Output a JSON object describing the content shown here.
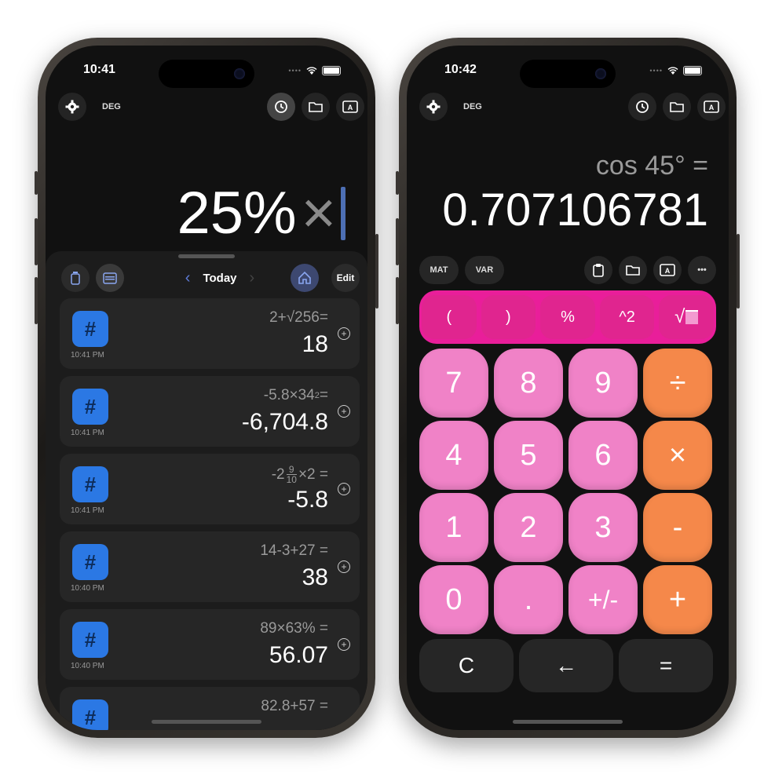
{
  "left_phone": {
    "time": "10:41",
    "deg": "DEG",
    "big_expression": "25%",
    "big_operator": "×",
    "history_nav": {
      "label": "Today",
      "edit": "Edit"
    },
    "history": [
      {
        "time": "10:41 PM",
        "expr_a": "2+",
        "expr_root": "√256",
        "expr_eq": " =",
        "result": "18"
      },
      {
        "time": "10:41 PM",
        "expr_a": "-5.8×34",
        "expr_sup": "2",
        "expr_eq": " =",
        "result": "-6,704.8"
      },
      {
        "time": "10:41 PM",
        "expr_a": "-2",
        "frac_num": "9",
        "frac_den": "10",
        "expr_b": "×2 =",
        "result": "-5.8"
      },
      {
        "time": "10:40 PM",
        "expr_a": "14-3+27 =",
        "result": "38"
      },
      {
        "time": "10:40 PM",
        "expr_a": "89×63% =",
        "result": "56.07"
      },
      {
        "expr_a": "82.8+57 ="
      }
    ],
    "hash_symbol": "#"
  },
  "right_phone": {
    "time": "10:42",
    "deg": "DEG",
    "expression": "cos 45° =",
    "result": "0.707106781",
    "chips": {
      "mat": "MAT",
      "var": "VAR",
      "more": "•••"
    },
    "sci_keys": [
      "(",
      ")",
      "%",
      "^2",
      "√"
    ],
    "keys": [
      [
        "7",
        "8",
        "9",
        "÷"
      ],
      [
        "4",
        "5",
        "6",
        "×"
      ],
      [
        "1",
        "2",
        "3",
        "-"
      ],
      [
        "0",
        ".",
        "+/-",
        "+"
      ]
    ],
    "bottom_keys": {
      "clear": "C",
      "back": "←",
      "equals": "="
    }
  },
  "colors": {
    "accent_blue": "#2b78e4",
    "pink_key": "#f082c7",
    "magenta_bar": "#e91e9a",
    "orange_key": "#f5884a"
  }
}
